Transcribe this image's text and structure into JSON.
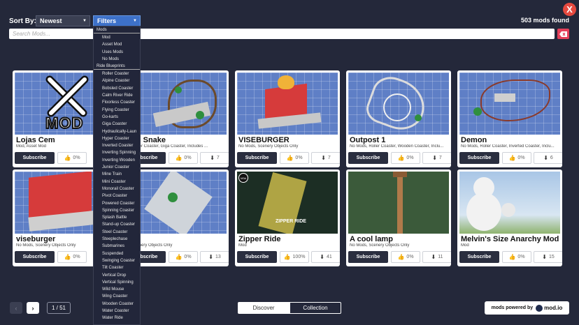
{
  "window": {
    "close_label": "X"
  },
  "toolbar": {
    "sort_label": "Sort By:",
    "sort_value": "Newest",
    "filter_value": "Filters",
    "mods_found": "503 mods found"
  },
  "search": {
    "placeholder": "Search Mods..."
  },
  "filter_dropdown": {
    "group_mods": "Mods",
    "mods_items": [
      "Mod",
      "Asset Mod",
      "Uses Mods",
      "No Mods"
    ],
    "group_blueprints": "Ride Blueprints",
    "blueprint_items": [
      "Roller Coaster",
      "Alpine Coaster",
      "Bobsled Coaster",
      "Calm River Ride",
      "Floorless Coaster",
      "Flying Coaster",
      "Go-karts",
      "Giga Coaster",
      "Hydraulically-Laun",
      "Hyper Coaster",
      "Inverted Coaster",
      "Inverting Spinning",
      "Inverting Wooden",
      "Junior Coaster",
      "Mine Train",
      "Mini Coaster",
      "Monorail Coaster",
      "Pivot Coaster",
      "Powered Coaster",
      "Spinning Coaster",
      "Splash Battle",
      "Stand-up Coaster",
      "Steel Coaster",
      "Steeplechase",
      "Submarines",
      "Suspended",
      "Swinging Coaster",
      "Tilt Coaster",
      "Vertical Drop",
      "Vertical Spinning",
      "Wild Mouse",
      "Wing Coaster",
      "Wooden Coaster",
      "Water Coaster",
      "Water Ride"
    ]
  },
  "cards": [
    {
      "title": "Lojas Cem",
      "tags": "Mod, Asset Mod",
      "likes": "0%",
      "downloads": "",
      "subscribe": "Subscribe",
      "thumb_label": "MOD"
    },
    {
      "title": "den Snake",
      "tags": "s, Roller Coaster, Giga Coaster, Includes ...",
      "likes": "0%",
      "downloads": "7",
      "subscribe": "Subscribe"
    },
    {
      "title": "VISEBURGER",
      "tags": "No Mods, Scenery Objects Only",
      "likes": "0%",
      "downloads": "7",
      "subscribe": "Subscribe"
    },
    {
      "title": "Outpost 1",
      "tags": "No Mods, Roller Coaster, Wooden Coaster, Inclu...",
      "likes": "0%",
      "downloads": "7",
      "subscribe": "Subscribe"
    },
    {
      "title": "Demon",
      "tags": "No Mods, Roller Coaster, Inverted Coaster, Inclu...",
      "likes": "0%",
      "downloads": "6",
      "subscribe": "Subscribe"
    },
    {
      "title": "viseburger",
      "tags": "No Mods, Scenery Objects Only",
      "likes": "0%",
      "downloads": "",
      "subscribe": "Subscribe"
    },
    {
      "title": "zza",
      "tags": "s, Scenery Objects Only",
      "likes": "0%",
      "downloads": "13",
      "subscribe": "Subscribe"
    },
    {
      "title": "Zipper Ride",
      "tags": "Mod",
      "likes": "100%",
      "downloads": "41",
      "subscribe": "Subscribe",
      "thumb_label": "ZIPPER RIDE",
      "badge": "M3d"
    },
    {
      "title": "A cool lamp",
      "tags": "No Mods, Scenery Objects Only",
      "likes": "0%",
      "downloads": "11",
      "subscribe": "Subscribe"
    },
    {
      "title": "Melvin's Size Anarchy Mod",
      "tags": "Mod",
      "likes": "0%",
      "downloads": "15",
      "subscribe": "Subscribe"
    }
  ],
  "pager": {
    "prev": "‹",
    "next": "›",
    "page": "1 / 51"
  },
  "tabs": {
    "discover": "Discover",
    "collection": "Collection"
  },
  "footer": {
    "powered_by": "mods powered by",
    "brand": "mod.io"
  },
  "colors": {
    "background": "#24283a",
    "accent": "#3d71c9",
    "danger": "#e5493f"
  }
}
